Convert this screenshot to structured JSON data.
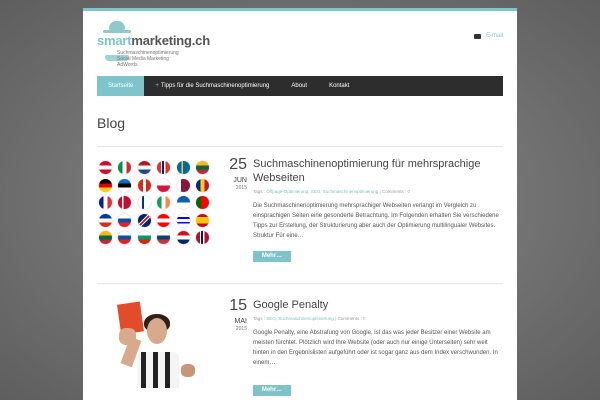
{
  "header": {
    "logo_smart": "smart",
    "logo_rest": "marketing.ch",
    "tagline_lines": [
      "Suchmaschinenoptimierung",
      "Social Media Marketing",
      "AdWords"
    ],
    "email_label": "E-mail"
  },
  "nav": {
    "items": [
      {
        "label": "Startseite",
        "active": true
      },
      {
        "label": "Tipps für die Suchmaschinenoptimierung",
        "prefix": "+"
      },
      {
        "label": "About"
      },
      {
        "label": "Kontakt"
      }
    ]
  },
  "page_title": "Blog",
  "posts": [
    {
      "day": "25",
      "month": "JUN",
      "year": "2015",
      "title": "Suchmaschinenoptimierung für mehrsprachige Webseiten",
      "meta_tags_label": "Tags :",
      "meta_tags": "Offpage-Optimierung, SEO, Suchmaschinenoptimierung",
      "meta_comments_label": "Comments :",
      "meta_comments": "0",
      "excerpt": "Die Suchmaschinenoptimierung mehrsprachiger Webseiten verlangt im Vergleich zu einsprachigen Seiten eine gesonderte Betrachtung. Im Folgenden erhalten Sie verschiedene Tipps zur Erstellung, der Strukturierung aber auch der Optimierung multilingualer Websites. Struktur Für eine…",
      "more_label": "Mehr…"
    },
    {
      "day": "15",
      "month": "MAI",
      "year": "2015",
      "title": "Google Penalty",
      "meta_tags_label": "Tags :",
      "meta_tags": "SEO, Suchmaschinenoptimierung",
      "meta_comments_label": "Comments :",
      "meta_comments": "0",
      "excerpt": "Google Penalty, eine Abstrafung von Google, ist das was jeder Besitzer einer Website am meisten fürchtet. Plötzlich wird Ihre Website (oder auch nur einige Unterseiten) sehr weit hinten in den Ergebnislisten aufgeführt oder ist sogar ganz aus dem Index verschwunden. In einem…",
      "more_label": "Mehr…"
    }
  ],
  "colors": {
    "accent": "#7ec4ca",
    "nav_bg": "#2d2d2d"
  },
  "icons": {
    "email": "envelope-icon",
    "logo": "hat-mustache-logo"
  }
}
